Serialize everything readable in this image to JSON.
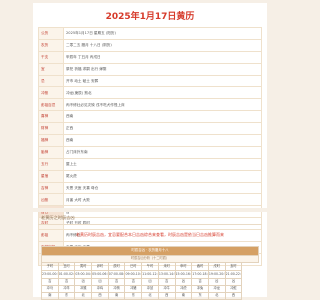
{
  "title": "2025年1月17日黄历",
  "info": [
    {
      "key": "公历",
      "value": "2025年1月17日 星期五 (阳历)"
    },
    {
      "key": "农历",
      "value": "二零二五 腊月 十八日 (阴历)"
    },
    {
      "key": "干支",
      "value": "甲辰年 丁丑月 丙戌日"
    },
    {
      "key": "宜",
      "value": "祭祀 祈福 求嗣 出行 嫁娶",
      "type": "jiri"
    },
    {
      "key": "忌",
      "value": "开市 动土 破土 安葬",
      "type": "xiong"
    },
    {
      "key": "冲煞",
      "value": "冲龙(庚辰) 煞北"
    },
    {
      "key": "彭祖百忌",
      "value": "丙不修灶必见灾殃 戌不吃犬作怪上床"
    },
    {
      "key": "喜神",
      "value": "西南"
    },
    {
      "key": "财神",
      "value": "正西"
    },
    {
      "key": "福神",
      "value": "西南"
    },
    {
      "key": "胎神",
      "value": "占门床外东南"
    },
    {
      "key": "五行",
      "value": "屋上土"
    },
    {
      "key": "星宿",
      "value": "尾火虎",
      "type": "jiri"
    },
    {
      "key": "吉神",
      "value": "天恩 天医 天喜 母仓",
      "type": "jiri"
    },
    {
      "key": "凶煞",
      "value": "月害 大时 大败",
      "type": "xiong"
    },
    {
      "key": "吉日",
      "value": "吉",
      "type": "xiong",
      "mark": true
    },
    {
      "key": "吉时",
      "value": "子时 丑时 辰时",
      "type": "jiri"
    },
    {
      "key": "彭祖",
      "value": "丙不修灶"
    },
    {
      "key": "吉神宜趋",
      "value": "天恩 天医 天喜"
    },
    {
      "key": "凶神宜忌",
      "value": "月害 大时"
    }
  ],
  "section": {
    "title": "老黄历之时辰吉凶",
    "note": "老黄历时辰吉凶，宜忌要配合本日吉凶综合来查看，时辰吉凶是依当日吉凶推算而来"
  },
  "hours": {
    "header": "时辰吉凶 · 农历腊月十八",
    "sub": "时辰吉凶分析（十二时辰）",
    "names": [
      "子时",
      "丑时",
      "寅时",
      "卯时",
      "辰时",
      "巳时",
      "午时",
      "未时",
      "申时",
      "酉时",
      "戌时",
      "亥时"
    ],
    "times": [
      "23:00-00:59",
      "01:00-02:59",
      "03:00-04:59",
      "05:00-06:59",
      "07:00-08:59",
      "09:00-10:59",
      "11:00-12:59",
      "13:00-14:59",
      "15:00-16:59",
      "17:00-18:59",
      "19:00-20:59",
      "21:00-22:59"
    ],
    "luck": [
      "吉",
      "吉",
      "凶",
      "凶",
      "吉",
      "吉",
      "凶",
      "吉",
      "凶",
      "吉",
      "凶",
      "凶"
    ],
    "chong": [
      "冲马",
      "冲羊",
      "冲猴",
      "冲鸡",
      "冲狗",
      "冲猪",
      "冲鼠",
      "冲牛",
      "冲虎",
      "冲兔",
      "冲龙",
      "冲蛇"
    ],
    "last_label": "冲煞",
    "last_values": [
      "南",
      "东",
      "北",
      "西",
      "南",
      "东",
      "北",
      "西",
      "南",
      "东",
      "北",
      "西"
    ]
  }
}
